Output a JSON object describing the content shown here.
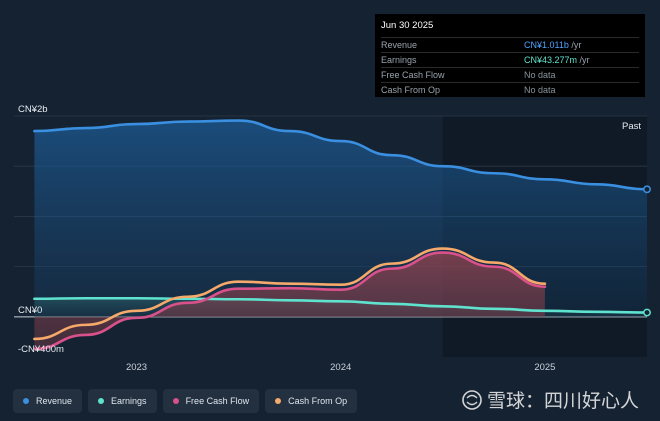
{
  "tooltip": {
    "date": "Jun 30 2025",
    "rows": [
      {
        "label": "Revenue",
        "value": "CN¥1.011b",
        "unit": " /yr"
      },
      {
        "label": "Earnings",
        "value": "CN¥43.277m",
        "unit": " /yr"
      },
      {
        "label": "Free Cash Flow",
        "value": "No data",
        "unit": ""
      },
      {
        "label": "Cash From Op",
        "value": "No data",
        "unit": ""
      }
    ]
  },
  "past_label": "Past",
  "watermark": "雪球：四川好心人",
  "colors": {
    "revenue": "#3a8fe0",
    "earnings": "#5fe3cf",
    "free_cash_flow": "#d9518a",
    "cash_from_op": "#f5a96a",
    "background": "#152232"
  },
  "legend": [
    {
      "label": "Revenue",
      "color": "#3a8fe0"
    },
    {
      "label": "Earnings",
      "color": "#5fe3cf"
    },
    {
      "label": "Free Cash Flow",
      "color": "#d9518a"
    },
    {
      "label": "Cash From Op",
      "color": "#f5a96a"
    }
  ],
  "chart_data": {
    "type": "area",
    "y_unit": "CN¥m",
    "ylim": [
      -400,
      2000
    ],
    "ytick_labels": [
      {
        "value": 2000,
        "label": "CN¥2b"
      },
      {
        "value": 0,
        "label": "CN¥0"
      },
      {
        "value": -400,
        "label": "-CN¥400m"
      }
    ],
    "xlim": [
      2022.4,
      2025.5
    ],
    "xtick_labels": [
      {
        "value": 2023,
        "label": "2023"
      },
      {
        "value": 2024,
        "label": "2024"
      },
      {
        "value": 2025,
        "label": "2025"
      }
    ],
    "past_region_start": 2024.5,
    "grid": true,
    "series": [
      {
        "name": "Revenue",
        "x": [
          2022.5,
          2022.75,
          2023.0,
          2023.25,
          2023.5,
          2023.75,
          2024.0,
          2024.25,
          2024.5,
          2024.75,
          2025.0,
          2025.25,
          2025.5
        ],
        "values": [
          1850,
          1880,
          1920,
          1945,
          1955,
          1850,
          1750,
          1610,
          1500,
          1430,
          1370,
          1320,
          1270
        ]
      },
      {
        "name": "Earnings",
        "x": [
          2022.5,
          2022.75,
          2023.0,
          2023.25,
          2023.5,
          2023.75,
          2024.0,
          2024.25,
          2024.5,
          2024.75,
          2025.0,
          2025.25,
          2025.5
        ],
        "values": [
          180,
          185,
          185,
          180,
          175,
          165,
          155,
          130,
          105,
          80,
          60,
          50,
          43
        ]
      },
      {
        "name": "Free Cash Flow",
        "x": [
          2022.5,
          2022.75,
          2023.0,
          2023.25,
          2023.5,
          2023.75,
          2024.0,
          2024.25,
          2024.5,
          2024.75,
          2025.0
        ],
        "values": [
          -320,
          -180,
          -10,
          140,
          280,
          285,
          270,
          480,
          640,
          500,
          300
        ]
      },
      {
        "name": "Cash From Op",
        "x": [
          2022.5,
          2022.75,
          2023.0,
          2023.25,
          2023.5,
          2023.75,
          2024.0,
          2024.25,
          2024.5,
          2024.75,
          2025.0
        ],
        "values": [
          -220,
          -80,
          60,
          200,
          350,
          330,
          320,
          530,
          680,
          540,
          330
        ]
      }
    ]
  }
}
